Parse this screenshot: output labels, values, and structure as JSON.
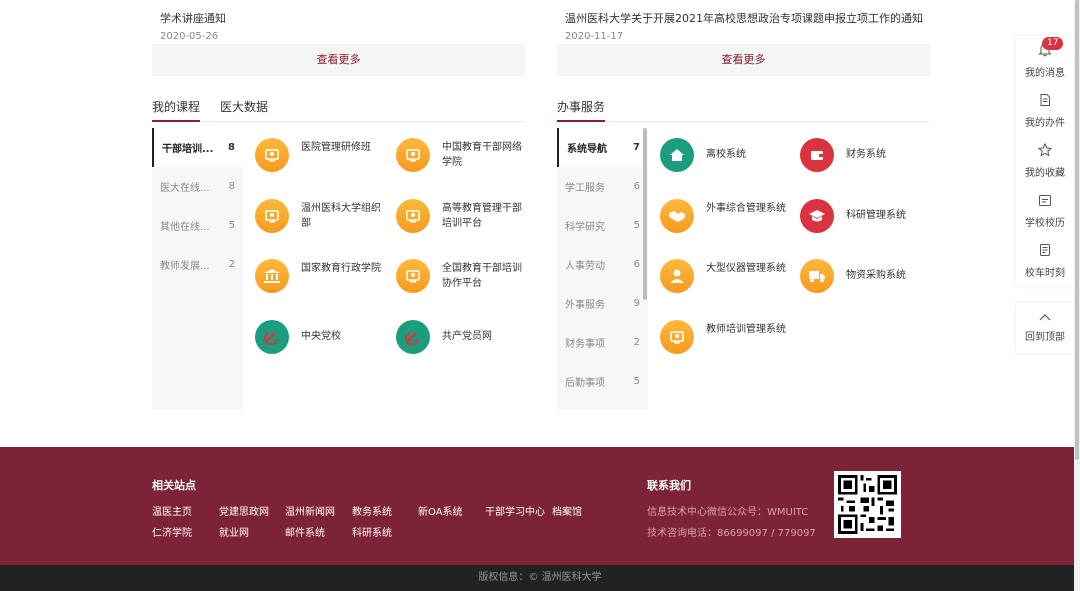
{
  "notices": {
    "left": {
      "title": "学术讲座通知",
      "date": "2020-05-26",
      "more": "查看更多"
    },
    "right": {
      "title": "温州医科大学关于开展2021年高校思想政治专项课题申报立项工作的通知",
      "date": "2020-11-17",
      "more": "查看更多"
    }
  },
  "courses": {
    "tabs": [
      "我的课程",
      "医大数据"
    ],
    "side": [
      {
        "label": "干部培训...",
        "count": "8"
      },
      {
        "label": "医大在线...",
        "count": "8"
      },
      {
        "label": "其他在线...",
        "count": "5"
      },
      {
        "label": "教师发展...",
        "count": "2"
      }
    ],
    "items": [
      {
        "label": "医院管理研修班",
        "icon": "certificate-icon",
        "color": "#f7a12a"
      },
      {
        "label": "中国教育干部网络学院",
        "icon": "certificate-icon",
        "color": "#f7a12a"
      },
      {
        "label": "温州医科大学组织部",
        "icon": "certificate-icon",
        "color": "#f7a12a"
      },
      {
        "label": "高等教育管理干部培训平台",
        "icon": "certificate-icon",
        "color": "#f7a12a"
      },
      {
        "label": "国家教育行政学院",
        "icon": "institution-icon",
        "color": "#f7a12a"
      },
      {
        "label": "全国教育干部培训协作平台",
        "icon": "certificate-icon",
        "color": "#f7a12a"
      },
      {
        "label": "中央党校",
        "icon": "party-emblem-icon",
        "color": "#1a9e7e"
      },
      {
        "label": "共产党员网",
        "icon": "party-emblem-icon",
        "color": "#1a9e7e"
      }
    ]
  },
  "services": {
    "tabs": [
      "办事服务"
    ],
    "side": [
      {
        "label": "系统导航",
        "count": "7"
      },
      {
        "label": "学工服务",
        "count": "6"
      },
      {
        "label": "科学研究",
        "count": "5"
      },
      {
        "label": "人事劳动",
        "count": "6"
      },
      {
        "label": "外事服务",
        "count": "9"
      },
      {
        "label": "财务事项",
        "count": "2"
      },
      {
        "label": "后勤事项",
        "count": "5"
      }
    ],
    "items": [
      {
        "label": "离校系统",
        "icon": "home-icon",
        "color": "#1a9e7e"
      },
      {
        "label": "财务系统",
        "icon": "wallet-icon",
        "color": "#d9333f"
      },
      {
        "label": "外事综合管理系统",
        "icon": "handshake-icon",
        "color": "#f7a12a"
      },
      {
        "label": "科研管理系统",
        "icon": "graduation-cap-icon",
        "color": "#d9333f"
      },
      {
        "label": "大型仪器管理系统",
        "icon": "person-icon",
        "color": "#f7a12a"
      },
      {
        "label": "物资采购系统",
        "icon": "truck-icon",
        "color": "#f7a12a"
      },
      {
        "label": "教师培训管理系统",
        "icon": "certificate-icon",
        "color": "#f7a12a"
      }
    ]
  },
  "footer": {
    "related_title": "相关站点",
    "links_row1": [
      "温医主页",
      "党建思政网",
      "温州新闻网",
      "教务系统",
      "新OA系统",
      "干部学习中心",
      "档案馆"
    ],
    "links_row2": [
      "仁济学院",
      "就业网",
      "邮件系统",
      "科研系统"
    ],
    "contact_title": "联系我们",
    "contact_wechat": "信息技术中心微信公众号：WMUITC",
    "contact_phone": "技术咨询电话：86699097 / 779097",
    "copyright": "版权信息：© 温州医科大学"
  },
  "right_panel": {
    "items": [
      {
        "label": "我的消息",
        "icon": "bell-icon",
        "badge": "17"
      },
      {
        "label": "我的办件",
        "icon": "document-icon"
      },
      {
        "label": "我的收藏",
        "icon": "star-icon"
      },
      {
        "label": "学校校历",
        "icon": "calendar-icon"
      },
      {
        "label": "校车时刻",
        "icon": "bus-schedule-icon"
      }
    ],
    "top_label": "回到顶部"
  },
  "colors": {
    "brand": "#8b1c2b",
    "footer": "#7d2337",
    "green": "#1a9e7e",
    "orange": "#f7a12a",
    "red": "#d9333f"
  }
}
